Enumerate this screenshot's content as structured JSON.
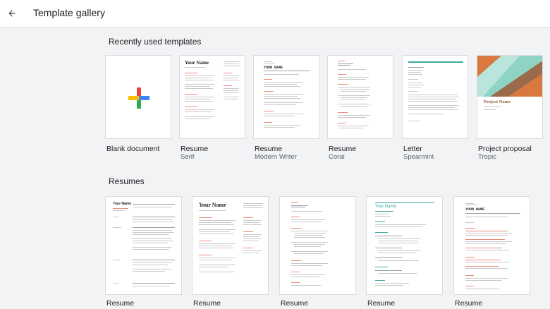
{
  "header": {
    "title": "Template gallery",
    "back_icon": "arrow-left-icon"
  },
  "sections": {
    "recent": {
      "title": "Recently used templates"
    },
    "resumes": {
      "title": "Resumes"
    }
  },
  "recent": [
    {
      "name": "Blank document",
      "sub": ""
    },
    {
      "name": "Resume",
      "sub": "Serif"
    },
    {
      "name": "Resume",
      "sub": "Modern Writer"
    },
    {
      "name": "Resume",
      "sub": "Coral"
    },
    {
      "name": "Letter",
      "sub": "Spearmint"
    },
    {
      "name": "Project proposal",
      "sub": "Tropic"
    }
  ],
  "resumes": [
    {
      "name": "Resume"
    },
    {
      "name": "Resume"
    },
    {
      "name": "Resume"
    },
    {
      "name": "Resume"
    },
    {
      "name": "Resume"
    }
  ],
  "thumb_text": {
    "your_name": "Your Name",
    "your_name_upper": "YOUR NAME",
    "project_name": "Project Name"
  },
  "colors": {
    "accent_teal": "#3aa9a0",
    "accent_coral": "#e98b7c",
    "tropic_mint": "#8fd3c5",
    "tropic_orange": "#d9783f",
    "tropic_brown": "#9a6a4a"
  }
}
